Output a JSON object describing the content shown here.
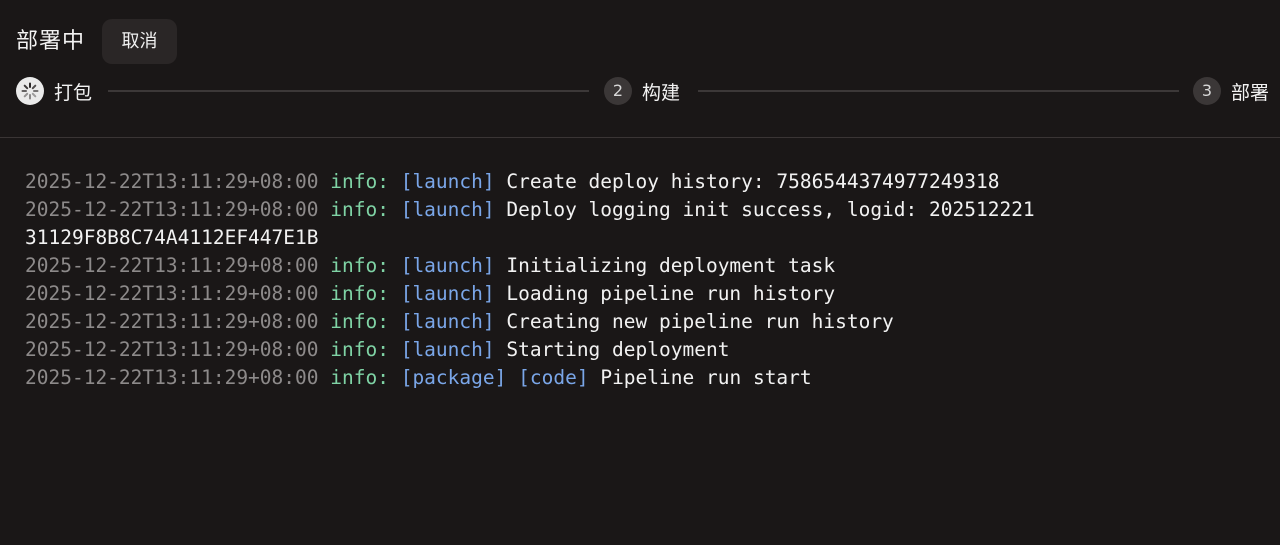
{
  "header": {
    "title": "部署中",
    "cancel_label": "取消"
  },
  "steps": [
    {
      "number": "",
      "label": "打包",
      "state": "active",
      "icon": "spinner-icon"
    },
    {
      "number": "2",
      "label": "构建",
      "state": "pending"
    },
    {
      "number": "3",
      "label": "部署",
      "state": "pending"
    }
  ],
  "colors": {
    "background": "#1a1717",
    "timestamp": "#8d8a8a",
    "level": "#7fd3a5",
    "tag": "#7aa6e8",
    "message": "#f2f2f2"
  },
  "log": [
    {
      "timestamp": "2025-12-22T13:11:29+08:00",
      "level": "info:",
      "tags": [
        "[launch]"
      ],
      "message": "Create deploy history: 7586544374977249318"
    },
    {
      "timestamp": "2025-12-22T13:11:29+08:00",
      "level": "info:",
      "tags": [
        "[launch]"
      ],
      "message": "Deploy logging init success, logid: 20251222131129F8B8C74A4112EF447E1B"
    },
    {
      "timestamp": "2025-12-22T13:11:29+08:00",
      "level": "info:",
      "tags": [
        "[launch]"
      ],
      "message": "Initializing deployment task"
    },
    {
      "timestamp": "2025-12-22T13:11:29+08:00",
      "level": "info:",
      "tags": [
        "[launch]"
      ],
      "message": "Loading pipeline run history"
    },
    {
      "timestamp": "2025-12-22T13:11:29+08:00",
      "level": "info:",
      "tags": [
        "[launch]"
      ],
      "message": "Creating new pipeline run history"
    },
    {
      "timestamp": "2025-12-22T13:11:29+08:00",
      "level": "info:",
      "tags": [
        "[launch]"
      ],
      "message": "Starting deployment"
    },
    {
      "timestamp": "2025-12-22T13:11:29+08:00",
      "level": "info:",
      "tags": [
        "[package]",
        "[code]"
      ],
      "message": "Pipeline run start"
    }
  ]
}
